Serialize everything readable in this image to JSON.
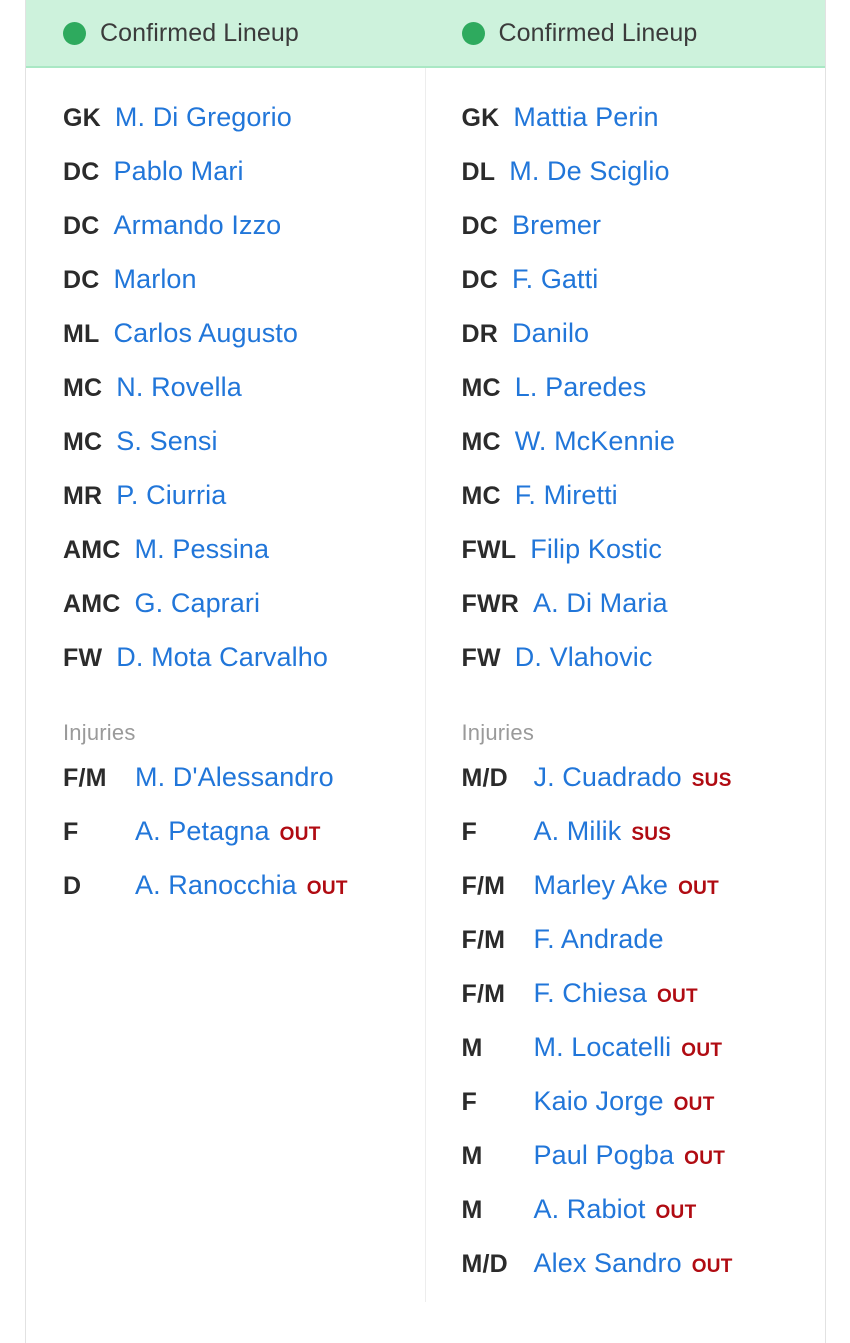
{
  "colors": {
    "header_bg": "#cdf2dc",
    "header_border": "#a9e8c4",
    "status_dot": "#2eaa5e",
    "player_link": "#2176d9",
    "position_text": "#2b2b2b",
    "injury_tag": "#b00b12",
    "injuries_heading": "#9a9a9a",
    "card_border": "#e2e2e2"
  },
  "home": {
    "header": {
      "status_label": "Confirmed Lineup",
      "status_icon": "green-dot"
    },
    "lineup": [
      {
        "pos": "GK",
        "name": "M. Di Gregorio"
      },
      {
        "pos": "DC",
        "name": "Pablo Mari"
      },
      {
        "pos": "DC",
        "name": "Armando Izzo"
      },
      {
        "pos": "DC",
        "name": "Marlon"
      },
      {
        "pos": "ML",
        "name": "Carlos Augusto"
      },
      {
        "pos": "MC",
        "name": "N. Rovella"
      },
      {
        "pos": "MC",
        "name": "S. Sensi"
      },
      {
        "pos": "MR",
        "name": "P. Ciurria"
      },
      {
        "pos": "AMC",
        "name": "M. Pessina"
      },
      {
        "pos": "AMC",
        "name": "G. Caprari"
      },
      {
        "pos": "FW",
        "name": "D. Mota Carvalho"
      }
    ],
    "injuries_heading": "Injuries",
    "injuries": [
      {
        "pos": "F/M",
        "name": "M. D'Alessandro",
        "tag": ""
      },
      {
        "pos": "F",
        "name": "A. Petagna",
        "tag": "OUT"
      },
      {
        "pos": "D",
        "name": "A. Ranocchia",
        "tag": "OUT"
      }
    ]
  },
  "away": {
    "header": {
      "status_label": "Confirmed Lineup",
      "status_icon": "green-dot"
    },
    "lineup": [
      {
        "pos": "GK",
        "name": "Mattia Perin"
      },
      {
        "pos": "DL",
        "name": "M. De Sciglio"
      },
      {
        "pos": "DC",
        "name": "Bremer"
      },
      {
        "pos": "DC",
        "name": "F. Gatti"
      },
      {
        "pos": "DR",
        "name": "Danilo"
      },
      {
        "pos": "MC",
        "name": "L. Paredes"
      },
      {
        "pos": "MC",
        "name": "W. McKennie"
      },
      {
        "pos": "MC",
        "name": "F. Miretti"
      },
      {
        "pos": "FWL",
        "name": "Filip Kostic"
      },
      {
        "pos": "FWR",
        "name": "A. Di Maria"
      },
      {
        "pos": "FW",
        "name": "D. Vlahovic"
      }
    ],
    "injuries_heading": "Injuries",
    "injuries": [
      {
        "pos": "M/D",
        "name": "J. Cuadrado",
        "tag": "SUS"
      },
      {
        "pos": "F",
        "name": "A. Milik",
        "tag": "SUS"
      },
      {
        "pos": "F/M",
        "name": "Marley Ake",
        "tag": "OUT"
      },
      {
        "pos": "F/M",
        "name": "F. Andrade",
        "tag": ""
      },
      {
        "pos": "F/M",
        "name": "F. Chiesa",
        "tag": "OUT"
      },
      {
        "pos": "M",
        "name": "M. Locatelli",
        "tag": "OUT"
      },
      {
        "pos": "F",
        "name": "Kaio Jorge",
        "tag": "OUT"
      },
      {
        "pos": "M",
        "name": "Paul Pogba",
        "tag": "OUT"
      },
      {
        "pos": "M",
        "name": "A. Rabiot",
        "tag": "OUT"
      },
      {
        "pos": "M/D",
        "name": "Alex Sandro",
        "tag": "OUT"
      }
    ]
  }
}
